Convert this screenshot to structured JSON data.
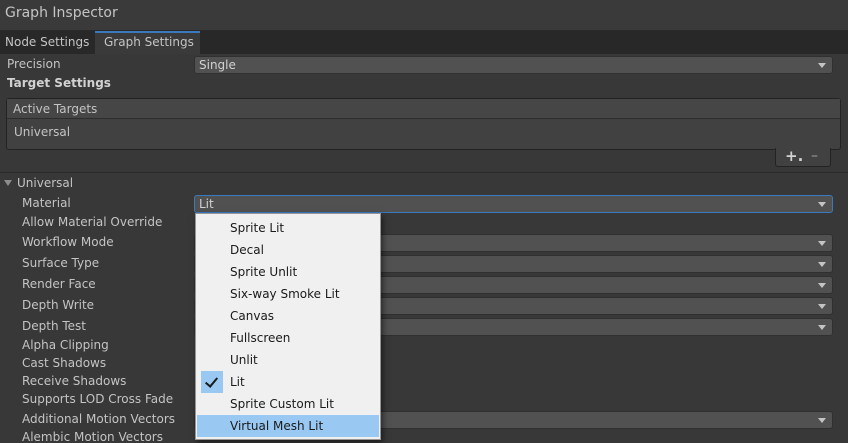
{
  "window": {
    "title": "Graph Inspector"
  },
  "tabs": [
    {
      "label": "Node Settings"
    },
    {
      "label": "Graph Settings"
    }
  ],
  "precision": {
    "label": "Precision",
    "value": "Single"
  },
  "target_settings": {
    "heading": "Target Settings",
    "active_targets_header": "Active Targets",
    "targets": [
      "Universal"
    ],
    "add_label": "+.",
    "remove_label": "–"
  },
  "universal": {
    "heading": "Universal",
    "material": {
      "label": "Material",
      "value": "Lit"
    },
    "fields": [
      "Allow Material Override",
      "Workflow Mode",
      "Surface Type",
      "Render Face",
      "Depth Write",
      "Depth Test",
      "Alpha Clipping",
      "Cast Shadows",
      "Receive Shadows",
      "Supports LOD Cross Fade",
      "Additional Motion Vectors",
      "Alembic Motion Vectors"
    ]
  },
  "material_menu": {
    "items": [
      "Sprite Lit",
      "Decal",
      "Sprite Unlit",
      "Six-way Smoke Lit",
      "Canvas",
      "Fullscreen",
      "Unlit",
      "Lit",
      "Sprite Custom Lit",
      "Virtual Mesh Lit"
    ],
    "checked": "Lit",
    "hovered": "Virtual Mesh Lit"
  },
  "colors": {
    "background": "#383838",
    "accent": "#3a79bb",
    "menu_highlight": "#99c9f3"
  }
}
